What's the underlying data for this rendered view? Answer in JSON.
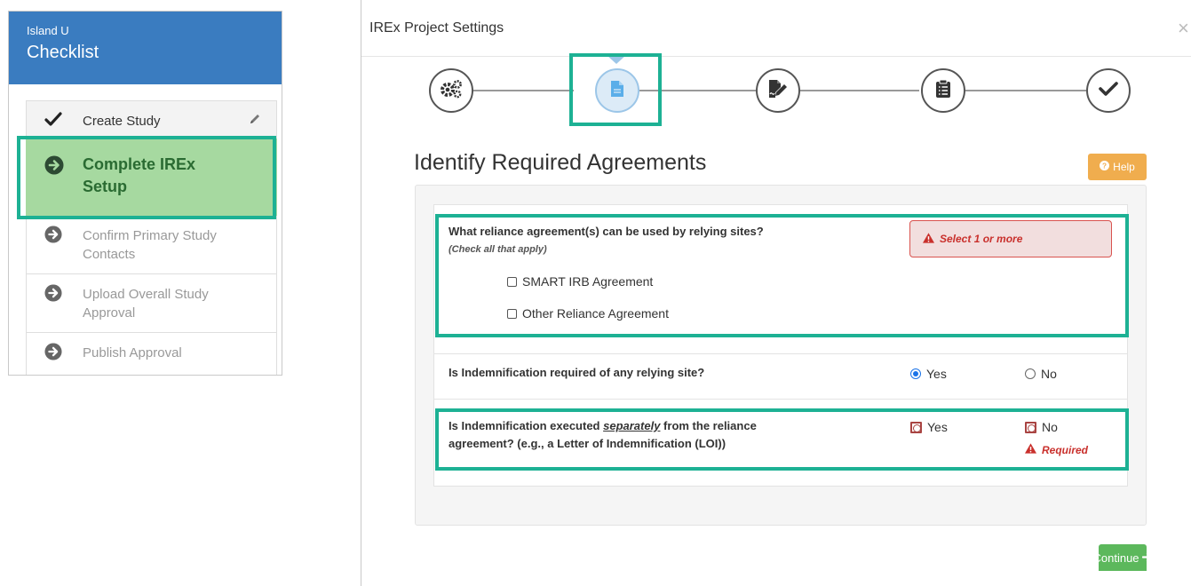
{
  "checklist": {
    "subtitle": "Island U",
    "title": "Checklist",
    "steps": [
      {
        "label": "Create Study",
        "state": "done",
        "icon": "check-icon"
      },
      {
        "label": "Complete IREx Setup",
        "state": "active",
        "icon": "arrow-circle-right-icon"
      },
      {
        "label": "Confirm Primary Study Contacts",
        "state": "pending",
        "icon": "arrow-circle-right-icon"
      },
      {
        "label": "Upload Overall Study Approval",
        "state": "pending",
        "icon": "arrow-circle-right-icon"
      },
      {
        "label": "Publish Approval",
        "state": "pending",
        "icon": "arrow-circle-right-icon"
      }
    ]
  },
  "modal": {
    "title": "IREx Project Settings",
    "close_glyph": "×",
    "wizard": [
      "gears-icon",
      "file-icon",
      "signature-icon",
      "clipboard-list-icon",
      "check-icon"
    ],
    "section_title": "Identify Required Agreements",
    "help_label": "Help",
    "continue_label": "Continue",
    "q1": {
      "text": "What reliance agreement(s) can be used by relying sites?",
      "hint": "(Check all that apply)",
      "options": [
        "SMART IRB Agreement",
        "Other Reliance Agreement"
      ],
      "error": "Select 1 or more"
    },
    "q2": {
      "text": "Is Indemnification required of any relying site?",
      "yes": "Yes",
      "no": "No",
      "selected": "Yes"
    },
    "q3": {
      "text_before": "Is Indemnification executed ",
      "text_emph": "separately",
      "text_after": " from the reliance agreement? (e.g., a Letter of Indemnification (LOI))",
      "yes": "Yes",
      "no": "No",
      "error": "Required"
    }
  },
  "colors": {
    "header_blue": "#3a7cc0",
    "active_green": "#a6d9a0",
    "highlight_teal": "#1db194",
    "help_orange": "#f0ad4e",
    "continue_green": "#5cb85c",
    "error_red": "#d9534f"
  }
}
